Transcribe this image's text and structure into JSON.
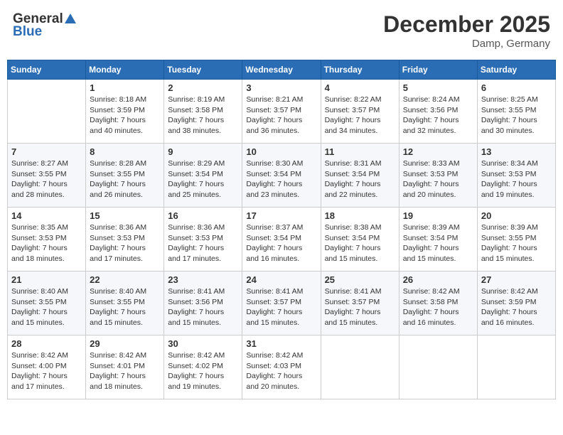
{
  "header": {
    "logo_general": "General",
    "logo_blue": "Blue",
    "month": "December 2025",
    "location": "Damp, Germany"
  },
  "weekdays": [
    "Sunday",
    "Monday",
    "Tuesday",
    "Wednesday",
    "Thursday",
    "Friday",
    "Saturday"
  ],
  "weeks": [
    [
      {
        "day": "",
        "sunrise": "",
        "sunset": "",
        "daylight": ""
      },
      {
        "day": "1",
        "sunrise": "Sunrise: 8:18 AM",
        "sunset": "Sunset: 3:59 PM",
        "daylight": "Daylight: 7 hours and 40 minutes."
      },
      {
        "day": "2",
        "sunrise": "Sunrise: 8:19 AM",
        "sunset": "Sunset: 3:58 PM",
        "daylight": "Daylight: 7 hours and 38 minutes."
      },
      {
        "day": "3",
        "sunrise": "Sunrise: 8:21 AM",
        "sunset": "Sunset: 3:57 PM",
        "daylight": "Daylight: 7 hours and 36 minutes."
      },
      {
        "day": "4",
        "sunrise": "Sunrise: 8:22 AM",
        "sunset": "Sunset: 3:57 PM",
        "daylight": "Daylight: 7 hours and 34 minutes."
      },
      {
        "day": "5",
        "sunrise": "Sunrise: 8:24 AM",
        "sunset": "Sunset: 3:56 PM",
        "daylight": "Daylight: 7 hours and 32 minutes."
      },
      {
        "day": "6",
        "sunrise": "Sunrise: 8:25 AM",
        "sunset": "Sunset: 3:55 PM",
        "daylight": "Daylight: 7 hours and 30 minutes."
      }
    ],
    [
      {
        "day": "7",
        "sunrise": "Sunrise: 8:27 AM",
        "sunset": "Sunset: 3:55 PM",
        "daylight": "Daylight: 7 hours and 28 minutes."
      },
      {
        "day": "8",
        "sunrise": "Sunrise: 8:28 AM",
        "sunset": "Sunset: 3:55 PM",
        "daylight": "Daylight: 7 hours and 26 minutes."
      },
      {
        "day": "9",
        "sunrise": "Sunrise: 8:29 AM",
        "sunset": "Sunset: 3:54 PM",
        "daylight": "Daylight: 7 hours and 25 minutes."
      },
      {
        "day": "10",
        "sunrise": "Sunrise: 8:30 AM",
        "sunset": "Sunset: 3:54 PM",
        "daylight": "Daylight: 7 hours and 23 minutes."
      },
      {
        "day": "11",
        "sunrise": "Sunrise: 8:31 AM",
        "sunset": "Sunset: 3:54 PM",
        "daylight": "Daylight: 7 hours and 22 minutes."
      },
      {
        "day": "12",
        "sunrise": "Sunrise: 8:33 AM",
        "sunset": "Sunset: 3:53 PM",
        "daylight": "Daylight: 7 hours and 20 minutes."
      },
      {
        "day": "13",
        "sunrise": "Sunrise: 8:34 AM",
        "sunset": "Sunset: 3:53 PM",
        "daylight": "Daylight: 7 hours and 19 minutes."
      }
    ],
    [
      {
        "day": "14",
        "sunrise": "Sunrise: 8:35 AM",
        "sunset": "Sunset: 3:53 PM",
        "daylight": "Daylight: 7 hours and 18 minutes."
      },
      {
        "day": "15",
        "sunrise": "Sunrise: 8:36 AM",
        "sunset": "Sunset: 3:53 PM",
        "daylight": "Daylight: 7 hours and 17 minutes."
      },
      {
        "day": "16",
        "sunrise": "Sunrise: 8:36 AM",
        "sunset": "Sunset: 3:53 PM",
        "daylight": "Daylight: 7 hours and 17 minutes."
      },
      {
        "day": "17",
        "sunrise": "Sunrise: 8:37 AM",
        "sunset": "Sunset: 3:54 PM",
        "daylight": "Daylight: 7 hours and 16 minutes."
      },
      {
        "day": "18",
        "sunrise": "Sunrise: 8:38 AM",
        "sunset": "Sunset: 3:54 PM",
        "daylight": "Daylight: 7 hours and 15 minutes."
      },
      {
        "day": "19",
        "sunrise": "Sunrise: 8:39 AM",
        "sunset": "Sunset: 3:54 PM",
        "daylight": "Daylight: 7 hours and 15 minutes."
      },
      {
        "day": "20",
        "sunrise": "Sunrise: 8:39 AM",
        "sunset": "Sunset: 3:55 PM",
        "daylight": "Daylight: 7 hours and 15 minutes."
      }
    ],
    [
      {
        "day": "21",
        "sunrise": "Sunrise: 8:40 AM",
        "sunset": "Sunset: 3:55 PM",
        "daylight": "Daylight: 7 hours and 15 minutes."
      },
      {
        "day": "22",
        "sunrise": "Sunrise: 8:40 AM",
        "sunset": "Sunset: 3:55 PM",
        "daylight": "Daylight: 7 hours and 15 minutes."
      },
      {
        "day": "23",
        "sunrise": "Sunrise: 8:41 AM",
        "sunset": "Sunset: 3:56 PM",
        "daylight": "Daylight: 7 hours and 15 minutes."
      },
      {
        "day": "24",
        "sunrise": "Sunrise: 8:41 AM",
        "sunset": "Sunset: 3:57 PM",
        "daylight": "Daylight: 7 hours and 15 minutes."
      },
      {
        "day": "25",
        "sunrise": "Sunrise: 8:41 AM",
        "sunset": "Sunset: 3:57 PM",
        "daylight": "Daylight: 7 hours and 15 minutes."
      },
      {
        "day": "26",
        "sunrise": "Sunrise: 8:42 AM",
        "sunset": "Sunset: 3:58 PM",
        "daylight": "Daylight: 7 hours and 16 minutes."
      },
      {
        "day": "27",
        "sunrise": "Sunrise: 8:42 AM",
        "sunset": "Sunset: 3:59 PM",
        "daylight": "Daylight: 7 hours and 16 minutes."
      }
    ],
    [
      {
        "day": "28",
        "sunrise": "Sunrise: 8:42 AM",
        "sunset": "Sunset: 4:00 PM",
        "daylight": "Daylight: 7 hours and 17 minutes."
      },
      {
        "day": "29",
        "sunrise": "Sunrise: 8:42 AM",
        "sunset": "Sunset: 4:01 PM",
        "daylight": "Daylight: 7 hours and 18 minutes."
      },
      {
        "day": "30",
        "sunrise": "Sunrise: 8:42 AM",
        "sunset": "Sunset: 4:02 PM",
        "daylight": "Daylight: 7 hours and 19 minutes."
      },
      {
        "day": "31",
        "sunrise": "Sunrise: 8:42 AM",
        "sunset": "Sunset: 4:03 PM",
        "daylight": "Daylight: 7 hours and 20 minutes."
      },
      {
        "day": "",
        "sunrise": "",
        "sunset": "",
        "daylight": ""
      },
      {
        "day": "",
        "sunrise": "",
        "sunset": "",
        "daylight": ""
      },
      {
        "day": "",
        "sunrise": "",
        "sunset": "",
        "daylight": ""
      }
    ]
  ]
}
